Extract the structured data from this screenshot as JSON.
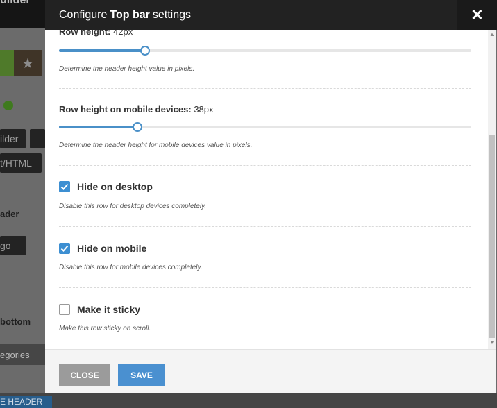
{
  "background": {
    "title": "uilder",
    "buttons": [
      "ilder",
      "t/HTML",
      "go"
    ],
    "labels": [
      "ader",
      "bottom"
    ],
    "categories": "egories",
    "header_button": "E HEADER"
  },
  "modal": {
    "title_prefix": "Configure",
    "title_bold": "Top bar",
    "title_suffix": "settings",
    "close_icon": "✕"
  },
  "settings": {
    "row_height": {
      "label": "Row height:",
      "value": "42px",
      "fraction": 0.209,
      "description": "Determine the header height value in pixels."
    },
    "row_height_mobile": {
      "label": "Row height on mobile devices:",
      "value": "38px",
      "fraction": 0.19,
      "description": "Determine the header height for mobile devices value in pixels."
    },
    "hide_desktop": {
      "label": "Hide on desktop",
      "checked": true,
      "description": "Disable this row for desktop devices completely."
    },
    "hide_mobile": {
      "label": "Hide on mobile",
      "checked": true,
      "description": "Disable this row for mobile devices completely."
    },
    "sticky": {
      "label": "Make it sticky",
      "checked": false,
      "description": "Make this row sticky on scroll."
    }
  },
  "footer": {
    "close_label": "CLOSE",
    "save_label": "SAVE"
  },
  "colors": {
    "accent": "#4a90c8",
    "header_bg": "#222222"
  }
}
